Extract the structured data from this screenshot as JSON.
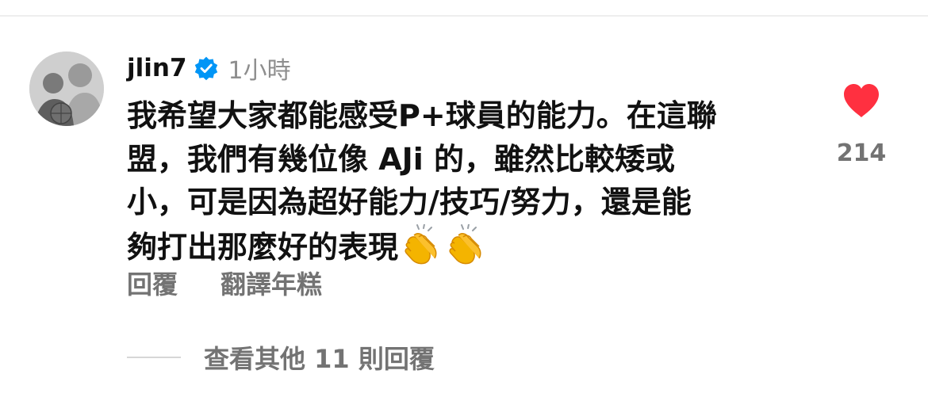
{
  "comment": {
    "username": "jlin7",
    "time": "1小時",
    "lines": [
      "我希望大家都能感受P+球員的能力。在這聯",
      "盟，我們有幾位像 AJi 的，雖然比較矮或",
      "小，可是因為超好能力/技巧/努力，還是能",
      "夠打出那麼好的表現"
    ],
    "trailing_emoji": [
      "clapping-hands",
      "clapping-hands"
    ]
  },
  "like": {
    "count": "214",
    "liked": true,
    "color": "#ff3040"
  },
  "actions": {
    "reply": "回覆",
    "translate": "翻譯年糕"
  },
  "replies": {
    "view_more": "查看其他 11 則回覆"
  },
  "icons": {
    "avatar": "profile-photo",
    "verified": "verified-badge-icon",
    "heart": "heart-icon"
  },
  "colors": {
    "verified_blue": "#0095f6",
    "secondary_text": "#737373"
  }
}
